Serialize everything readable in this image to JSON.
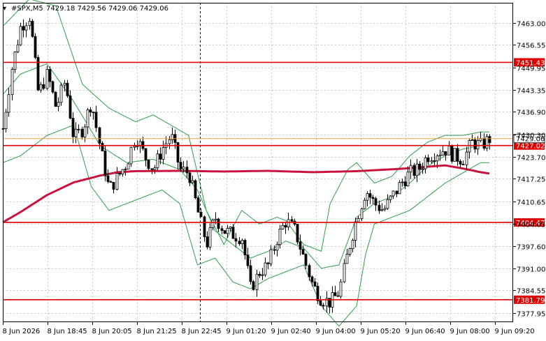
{
  "header": {
    "symbol": "#SPX,M5",
    "ohlc": "7429.18 7429.56 7429.06 7429.06"
  },
  "colors": {
    "background": "#ffffff",
    "grid": "#c8c8c8",
    "candle": "#000000",
    "bollinger": "#2e9e4a",
    "ma": "#c8143c",
    "level": "#e00000",
    "last_price": "#e8a040"
  },
  "chart_data": {
    "type": "candlestick",
    "title": "#SPX,M5",
    "ylim": [
      7375.2,
      7468.9
    ],
    "grid": true,
    "y_ticks": [
      "7463.00",
      "7456.55",
      "7449.95",
      "7443.35",
      "7436.90",
      "7430.30",
      "7423.70",
      "7417.25",
      "7410.65",
      "7404.05",
      "7397.60",
      "7391.00",
      "7384.55",
      "7377.95"
    ],
    "x_ticks": [
      "8 Jun 2026",
      "8 Jun 18:45",
      "8 Jun 20:05",
      "8 Jun 21:25",
      "8 Jun 22:45",
      "9 Jun 01:20",
      "9 Jun 02:40",
      "9 Jun 04:00",
      "9 Jun 05:20",
      "9 Jun 06:40",
      "9 Jun 08:00",
      "9 Jun 09:20"
    ],
    "last_price": {
      "value": 7429.06,
      "label": "7429.06"
    },
    "levels": [
      {
        "value": 7451.43,
        "label": "7451.43"
      },
      {
        "value": 7427.02,
        "label": "7427.02"
      },
      {
        "value": 7404.47,
        "label": "7404.47"
      },
      {
        "value": 7381.79,
        "label": "7381.79"
      }
    ],
    "session_separator_tick": 4.4,
    "close_path": [
      [
        0,
        7432
      ],
      [
        1,
        7450
      ],
      [
        2,
        7462
      ],
      [
        3,
        7465
      ],
      [
        4,
        7442
      ],
      [
        5,
        7448
      ],
      [
        6,
        7438
      ],
      [
        7,
        7446
      ],
      [
        8,
        7429
      ],
      [
        9,
        7432
      ],
      [
        10,
        7440
      ],
      [
        11,
        7426
      ],
      [
        12,
        7414
      ],
      [
        13,
        7418
      ],
      [
        14,
        7422
      ],
      [
        15,
        7430
      ],
      [
        16,
        7424
      ],
      [
        17,
        7420
      ],
      [
        18,
        7426
      ],
      [
        19,
        7430
      ],
      [
        20,
        7420
      ],
      [
        21,
        7419
      ],
      [
        22,
        7408
      ],
      [
        23,
        7398
      ],
      [
        24,
        7406
      ],
      [
        25,
        7402
      ],
      [
        26,
        7401
      ],
      [
        27,
        7400
      ],
      [
        28,
        7385
      ],
      [
        29,
        7390
      ],
      [
        30,
        7392
      ],
      [
        31,
        7400
      ],
      [
        32,
        7405
      ],
      [
        33,
        7402
      ],
      [
        34,
        7394
      ],
      [
        35,
        7386
      ],
      [
        36,
        7382
      ],
      [
        37,
        7381
      ],
      [
        38,
        7384
      ],
      [
        39,
        7396
      ],
      [
        40,
        7406
      ],
      [
        41,
        7414
      ],
      [
        42,
        7410
      ],
      [
        43,
        7408
      ],
      [
        44,
        7412
      ],
      [
        45,
        7416
      ],
      [
        46,
        7419
      ],
      [
        47,
        7420
      ],
      [
        48,
        7424
      ],
      [
        49,
        7425
      ],
      [
        50,
        7426
      ],
      [
        51,
        7424
      ],
      [
        52,
        7423
      ],
      [
        53,
        7428
      ],
      [
        54,
        7427
      ],
      [
        55,
        7429
      ]
    ],
    "ma_path": [
      [
        0,
        7404.5
      ],
      [
        2,
        7407.5
      ],
      [
        5,
        7412.5
      ],
      [
        8,
        7416.2
      ],
      [
        11,
        7418.2
      ],
      [
        13,
        7419.2
      ],
      [
        15,
        7419.5
      ],
      [
        20,
        7419.6
      ],
      [
        25,
        7419.4
      ],
      [
        30,
        7419.6
      ],
      [
        35,
        7419.2
      ],
      [
        40,
        7419.5
      ],
      [
        45,
        7420.2
      ],
      [
        48,
        7420.8
      ],
      [
        50,
        7421.2
      ],
      [
        52,
        7420.3
      ],
      [
        54,
        7419.2
      ],
      [
        55,
        7418.8
      ]
    ],
    "bb_upper_path": [
      [
        0,
        7462
      ],
      [
        3,
        7470
      ],
      [
        6,
        7468
      ],
      [
        9,
        7445
      ],
      [
        12,
        7438
      ],
      [
        15,
        7434
      ],
      [
        17,
        7436
      ],
      [
        19,
        7433
      ],
      [
        21,
        7430
      ],
      [
        23,
        7408
      ],
      [
        25,
        7398
      ],
      [
        27,
        7408
      ],
      [
        29,
        7404
      ],
      [
        31,
        7406
      ],
      [
        32,
        7405
      ],
      [
        34,
        7398
      ],
      [
        36,
        7396
      ],
      [
        37,
        7410
      ],
      [
        39,
        7420
      ],
      [
        40,
        7422
      ],
      [
        42,
        7416
      ],
      [
        44,
        7418
      ],
      [
        46,
        7424
      ],
      [
        48,
        7428
      ],
      [
        50,
        7430
      ],
      [
        52,
        7430
      ],
      [
        54,
        7431
      ],
      [
        55,
        7431
      ]
    ],
    "bb_mid_path": [
      [
        0,
        7442
      ],
      [
        2,
        7448
      ],
      [
        5,
        7451
      ],
      [
        8,
        7440
      ],
      [
        11,
        7427
      ],
      [
        14,
        7422
      ],
      [
        17,
        7423
      ],
      [
        20,
        7420
      ],
      [
        22,
        7414
      ],
      [
        24,
        7402
      ],
      [
        26,
        7398
      ],
      [
        28,
        7394
      ],
      [
        30,
        7396
      ],
      [
        32,
        7399
      ],
      [
        34,
        7397
      ],
      [
        36,
        7391
      ],
      [
        38,
        7392
      ],
      [
        40,
        7406
      ],
      [
        42,
        7410
      ],
      [
        44,
        7412
      ],
      [
        46,
        7416
      ],
      [
        48,
        7421
      ],
      [
        50,
        7424
      ],
      [
        52,
        7426
      ],
      [
        54,
        7427
      ],
      [
        55,
        7428
      ]
    ],
    "bb_lower_path": [
      [
        0,
        7422
      ],
      [
        2,
        7424
      ],
      [
        5,
        7430
      ],
      [
        8,
        7433
      ],
      [
        10,
        7415
      ],
      [
        12,
        7408
      ],
      [
        14,
        7410
      ],
      [
        16,
        7412
      ],
      [
        18,
        7414
      ],
      [
        20,
        7410
      ],
      [
        22,
        7392
      ],
      [
        24,
        7394
      ],
      [
        26,
        7387
      ],
      [
        28,
        7385
      ],
      [
        30,
        7388
      ],
      [
        32,
        7390
      ],
      [
        34,
        7392
      ],
      [
        36,
        7380
      ],
      [
        38,
        7374
      ],
      [
        40,
        7380
      ],
      [
        41,
        7395
      ],
      [
        42,
        7404
      ],
      [
        44,
        7406
      ],
      [
        46,
        7408
      ],
      [
        48,
        7412
      ],
      [
        50,
        7416
      ],
      [
        52,
        7419
      ],
      [
        54,
        7422
      ],
      [
        55,
        7422
      ]
    ]
  }
}
